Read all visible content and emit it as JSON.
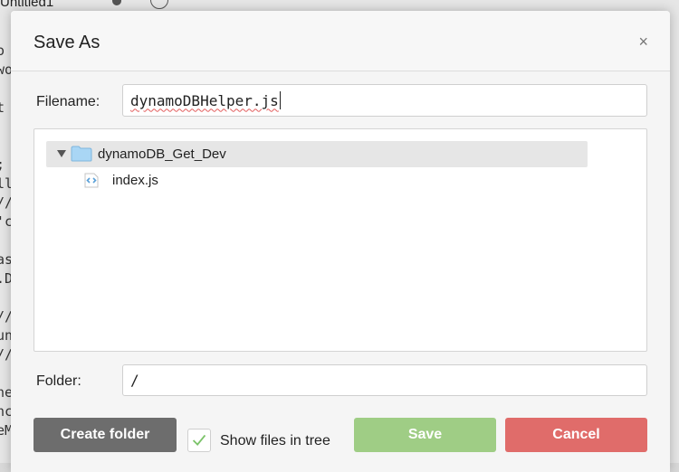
{
  "background": {
    "tab_label": "Untitled1",
    "code_fragments": [
      "o",
      "wo",
      "t",
      ";",
      "ll",
      "//",
      "'c",
      "as",
      ".D",
      "//",
      "un",
      "//",
      "ne",
      "nc",
      "eM"
    ]
  },
  "dialog": {
    "title": "Save As",
    "close_glyph": "×",
    "filename_label": "Filename:",
    "filename_value": "dynamoDBHelper.js",
    "tree": {
      "folder_name": "dynamoDB_Get_Dev",
      "folder_expanded": true,
      "files": [
        "index.js"
      ]
    },
    "folder_label": "Folder:",
    "folder_value": "/",
    "show_files_checked": true,
    "show_files_label": "Show files in tree",
    "buttons": {
      "create_folder": "Create folder",
      "save": "Save",
      "cancel": "Cancel"
    }
  },
  "icons": {
    "close": "close-icon",
    "expand": "triangle-down-icon",
    "folder": "folder-icon",
    "file": "js-file-icon",
    "check": "checkmark-icon"
  },
  "colors": {
    "create_button": "#6d6d6d",
    "save_button": "#9fcd85",
    "cancel_button": "#e06c6a",
    "folder_icon": "#a9d6f5",
    "checkmark": "#7cc36a"
  }
}
